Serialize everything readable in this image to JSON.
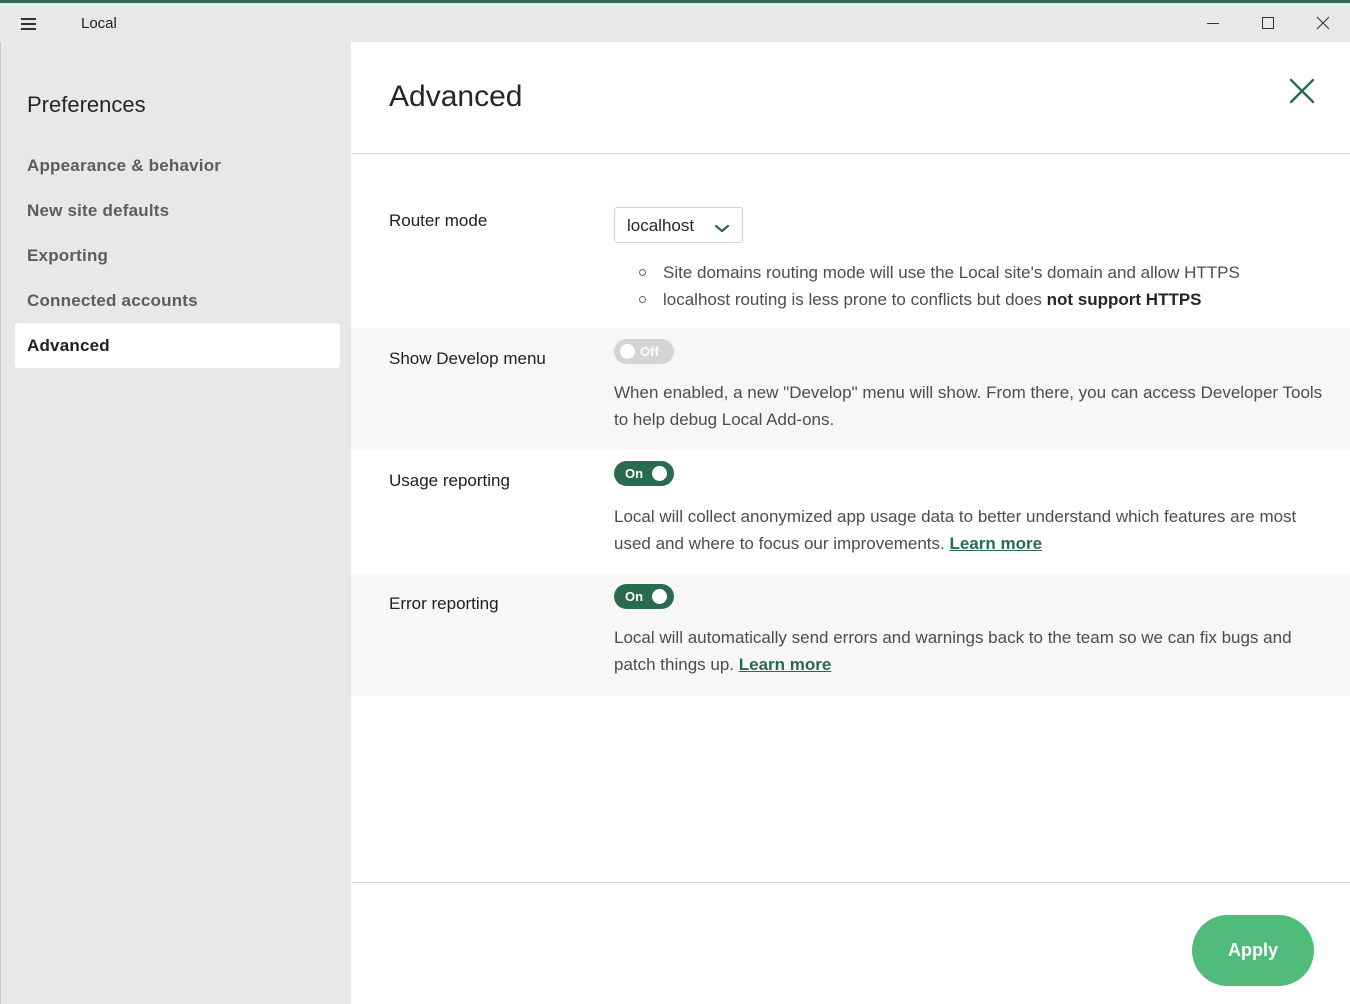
{
  "window": {
    "app_title": "Local",
    "menu_icon": "hamburger-menu-icon",
    "controls": [
      "minimize-icon",
      "maximize-icon",
      "close-icon"
    ]
  },
  "sidebar": {
    "title": "Preferences",
    "items": [
      {
        "label": "Appearance & behavior",
        "active": false
      },
      {
        "label": "New site defaults",
        "active": false
      },
      {
        "label": "Exporting",
        "active": false
      },
      {
        "label": "Connected accounts",
        "active": false
      },
      {
        "label": "Advanced",
        "active": true
      }
    ]
  },
  "main": {
    "title": "Advanced",
    "router_mode": {
      "label": "Router mode",
      "selected": "localhost",
      "bullets": [
        {
          "text": "Site domains routing mode will use the Local site's domain and allow HTTPS",
          "bold": ""
        },
        {
          "text": "localhost routing is less prone to conflicts but does ",
          "bold": "not support HTTPS"
        }
      ]
    },
    "develop_menu": {
      "label": "Show Develop menu",
      "toggle": "Off",
      "enabled": false,
      "description": "When enabled, a new \"Develop\" menu will show. From there, you can access Developer Tools to help debug Local Add-ons."
    },
    "usage_reporting": {
      "label": "Usage reporting",
      "toggle": "On",
      "enabled": true,
      "description": "Local will collect anonymized app usage data to better understand which features are most used and where to focus our improvements. ",
      "link": "Learn more"
    },
    "error_reporting": {
      "label": "Error reporting",
      "toggle": "On",
      "enabled": true,
      "description": "Local will automatically send errors and warnings back to the team so we can fix bugs and patch things up. ",
      "link": "Learn more"
    },
    "apply_label": "Apply"
  },
  "colors": {
    "accent_green": "#2a6b4f",
    "apply_green": "#51bb7b",
    "sidebar_bg": "#e8e8e8",
    "row_shade": "#f7f7f7"
  }
}
